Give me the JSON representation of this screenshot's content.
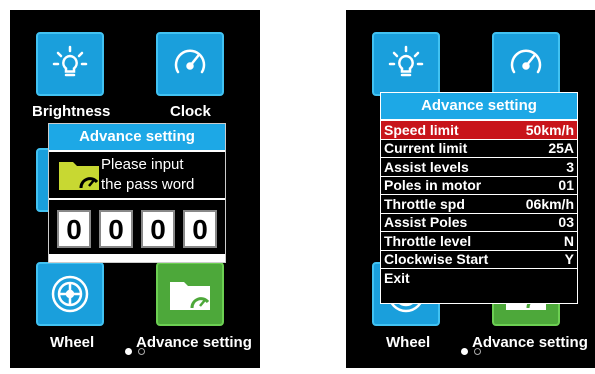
{
  "left_screen": {
    "tiles": {
      "brightness_label": "Brightness",
      "clock_label": "Clock",
      "wheel_label": "Wheel",
      "advance_label": "Advance setting"
    },
    "password_dialog": {
      "title": "Advance setting",
      "prompt_line1": "Please input",
      "prompt_line2": "the pass word",
      "digits": [
        "0",
        "0",
        "0",
        "0"
      ]
    },
    "page_indicator": {
      "current": 1,
      "total": 2
    }
  },
  "right_screen": {
    "tiles": {
      "wheel_label": "Wheel",
      "advance_label": "Advance setting"
    },
    "menu": {
      "title": "Advance setting",
      "items": [
        {
          "label": "Speed limit",
          "value": "50km/h",
          "selected": true
        },
        {
          "label": "Current limit",
          "value": "25A"
        },
        {
          "label": "Assist levels",
          "value": "3"
        },
        {
          "label": "Poles in motor",
          "value": "01"
        },
        {
          "label": "Throttle spd",
          "value": "06km/h"
        },
        {
          "label": "Assist Poles",
          "value": "03"
        },
        {
          "label": "Throttle level",
          "value": "N"
        },
        {
          "label": "Clockwise Start",
          "value": "Y"
        },
        {
          "label": "Exit",
          "value": ""
        }
      ]
    },
    "page_indicator": {
      "current": 1,
      "total": 2
    }
  },
  "colors": {
    "tile_blue": "#1a9fdc",
    "tile_green": "#4da83a",
    "title_blue": "#1da8e6",
    "selected_red": "#c8141a",
    "folder_yellow": "#c8d832"
  },
  "icons": [
    "lightbulb-icon",
    "speedometer-icon",
    "wheel-icon",
    "folder-gauge-icon"
  ]
}
